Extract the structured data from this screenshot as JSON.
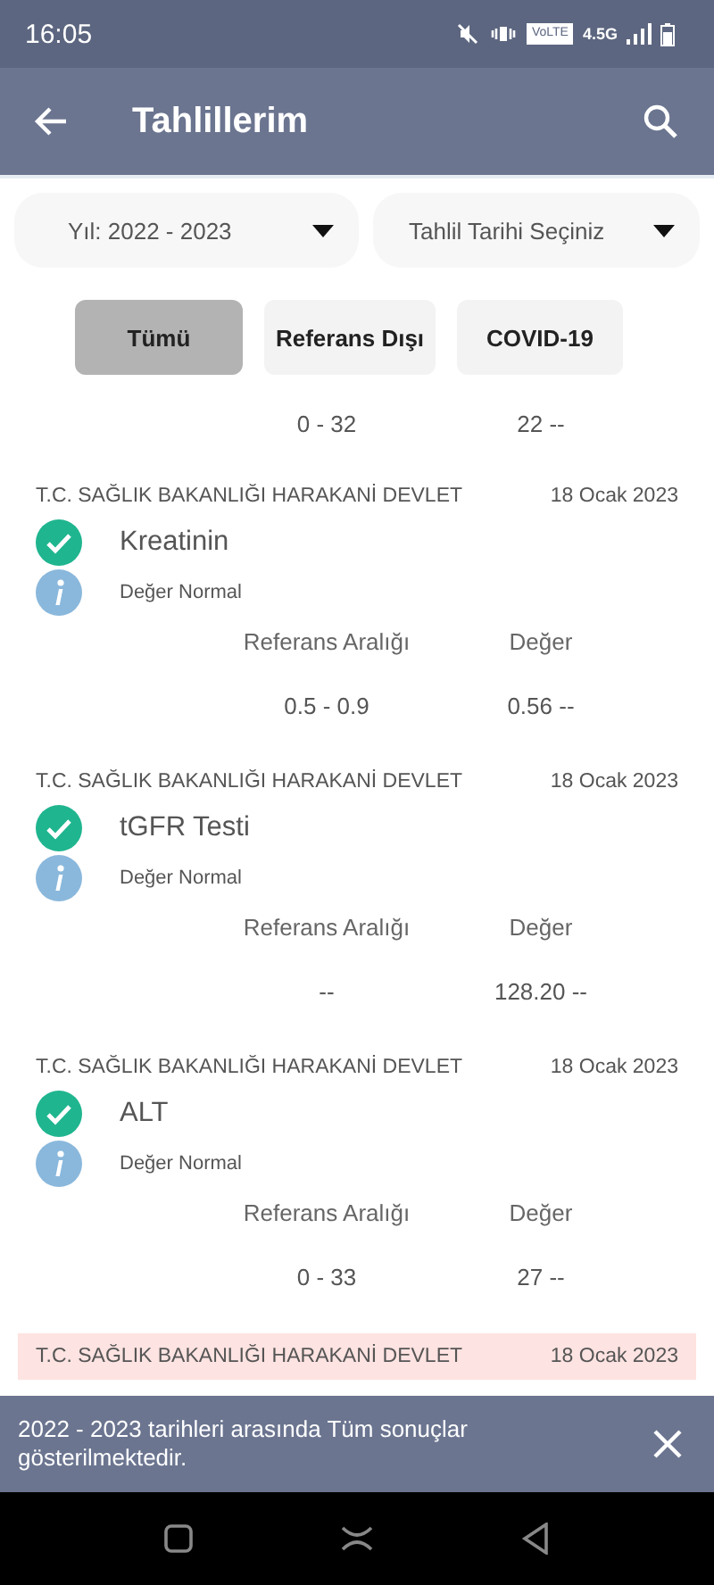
{
  "status_bar": {
    "time": "16:05",
    "network_badge": "VoLTE",
    "network_type": "4.5G"
  },
  "app_bar": {
    "title": "Tahlillerim"
  },
  "filters": [
    {
      "label": "Yıl: 2022 - 2023"
    },
    {
      "label": "Tahlil Tarihi Seçiniz"
    }
  ],
  "tabs": [
    {
      "label": "Tümü",
      "selected": true
    },
    {
      "label": "Referans Dışı",
      "selected": false
    },
    {
      "label": "COVID-19",
      "selected": false
    }
  ],
  "partial_result": {
    "range": "0 - 32",
    "value": "22 --"
  },
  "results": [
    {
      "hospital": "T.C. SAĞLIK BAKANLIĞI HARAKANİ DEVLET",
      "date": "18 Ocak 2023",
      "out_of_range": false,
      "name": "Kreatinin",
      "note": "Değer Normal",
      "range_label": "Referans Aralığı",
      "value_label": "Değer",
      "range": "0.5 - 0.9",
      "value": "0.56 --"
    },
    {
      "hospital": "T.C. SAĞLIK BAKANLIĞI HARAKANİ DEVLET",
      "date": "18 Ocak 2023",
      "out_of_range": false,
      "name": "tGFR Testi",
      "note": "Değer Normal",
      "range_label": "Referans Aralığı",
      "value_label": "Değer",
      "range": "--",
      "value": "128.20 --"
    },
    {
      "hospital": "T.C. SAĞLIK BAKANLIĞI HARAKANİ DEVLET",
      "date": "18 Ocak 2023",
      "out_of_range": false,
      "name": "ALT",
      "note": "Değer Normal",
      "range_label": "Referans Aralığı",
      "value_label": "Değer",
      "range": "0 - 33",
      "value": "27 --"
    },
    {
      "hospital": "T.C. SAĞLIK BAKANLIĞI HARAKANİ DEVLET",
      "date": "18 Ocak 2023",
      "out_of_range": true
    }
  ],
  "snackbar": {
    "message": "2022 - 2023 tarihleri arasında Tüm sonuçlar gösterilmektedir."
  }
}
